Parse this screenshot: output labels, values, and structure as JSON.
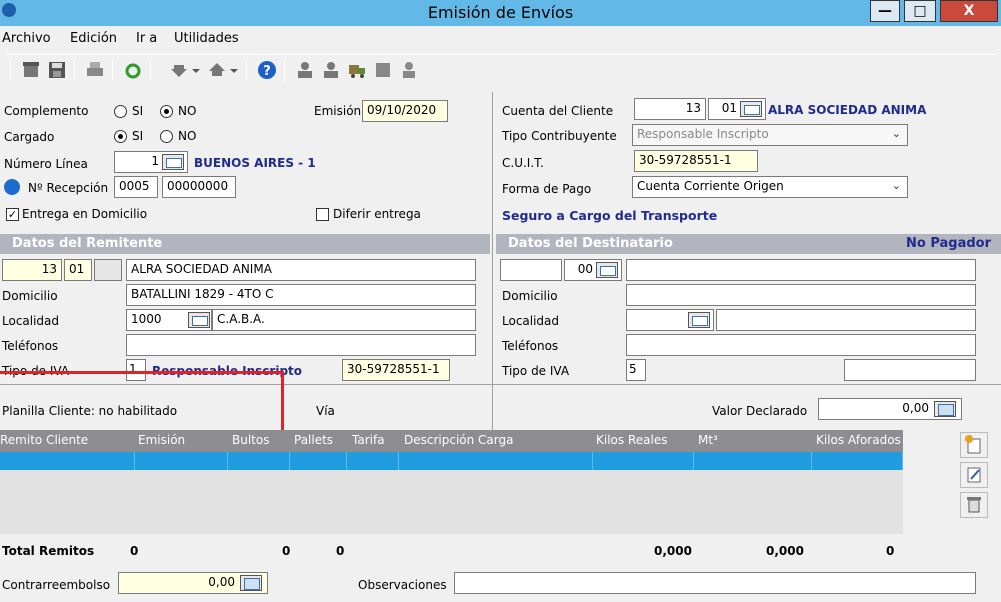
{
  "window": {
    "title": "Emisión de Envíos",
    "minimize": "—",
    "maximize": "□",
    "close": "X"
  },
  "menu": [
    "Archivo",
    "Edición",
    "Ir a",
    "Utilidades"
  ],
  "toolbar": {
    "icons": [
      "new-icon",
      "save-icon",
      "print-icon",
      "refresh-icon",
      "down-arrow-icon",
      "up-arrow-icon",
      "help-icon",
      "user-icon",
      "users-icon",
      "truck-icon",
      "stop-icon",
      "person-icon"
    ],
    "help_glyph": "?"
  },
  "left": {
    "complemento_label": "Complemento",
    "si": "SI",
    "no": "NO",
    "cargado_label": "Cargado",
    "numero_linea_label": "Número Línea",
    "numero_linea_value": "1",
    "numero_linea_desc": "BUENOS AIRES - 1",
    "recepcion_label": "Nº Recepción",
    "recepcion_serie": "0005",
    "recepcion_numero": "00000000",
    "entrega_label": "Entrega en Domicilio",
    "diferir_label": "Diferir entrega",
    "emision_label": "Emisión",
    "emision_value": "09/10/2020",
    "check_mark": "✓"
  },
  "right": {
    "cuenta_label": "Cuenta del Cliente",
    "cuenta_num": "13",
    "cuenta_sub": "01",
    "cuenta_name": "ALRA SOCIEDAD ANIMA",
    "tipo_contrib_label": "Tipo Contribuyente",
    "tipo_contrib_value": "Responsable Inscripto",
    "cuit_label": "C.U.I.T.",
    "cuit_value": "30-59728551-1",
    "forma_pago_label": "Forma de Pago",
    "forma_pago_value": "Cuenta Corriente Origen",
    "seguro": "Seguro a Cargo del Transporte",
    "arrow": "⌄"
  },
  "remitente": {
    "header": "Datos del Remitente",
    "num": "13",
    "sub": "01",
    "name": "ALRA SOCIEDAD ANIMA",
    "domicilio_label": "Domicilio",
    "domicilio": "BATALLINI 1829 - 4TO C",
    "localidad_label": "Localidad",
    "cp": "1000",
    "localidad": "C.A.B.A.",
    "telefonos_label": "Teléfonos",
    "iva_label": "Tipo de IVA",
    "iva_code": "1",
    "iva_desc": "Responsable Inscripto",
    "cuit": "30-59728551-1"
  },
  "destinatario": {
    "header": "Datos del Destinatario",
    "no_pagador": "No Pagador",
    "sub": "00",
    "domicilio_label": "Domicilio",
    "localidad_label": "Localidad",
    "telefonos_label": "Teléfonos",
    "iva_label": "Tipo de IVA",
    "iva_code": "5"
  },
  "planilla": {
    "text": "Planilla Cliente: no habilitado",
    "via_label": "Vía",
    "valor_label": "Valor Declarado",
    "valor_value": "0,00"
  },
  "grid": {
    "columns": [
      "Remito Cliente",
      "Emisión",
      "Bultos",
      "Pallets",
      "Tarifa",
      "Descripción Carga",
      "Kilos Reales",
      "Mt³",
      "Kilos Aforados"
    ],
    "side_buttons": [
      "add-row-icon",
      "edit-icon",
      "delete-icon"
    ]
  },
  "totals": {
    "label": "Total Remitos",
    "remitos": "0",
    "bultos": "0",
    "pallets": "0",
    "kilos_reales": "0,000",
    "mt3": "0,000",
    "kilos_aforados": "0"
  },
  "footer": {
    "contrareembolso_label": "Contrarreembolso",
    "contrareembolso_value": "0,00",
    "observaciones_label": "Observaciones"
  },
  "colors": {
    "titlebar": "#62b8e6",
    "selected_row": "#1f9de0",
    "accent_text": "#1f2b8f",
    "highlight": "#e0232b"
  }
}
